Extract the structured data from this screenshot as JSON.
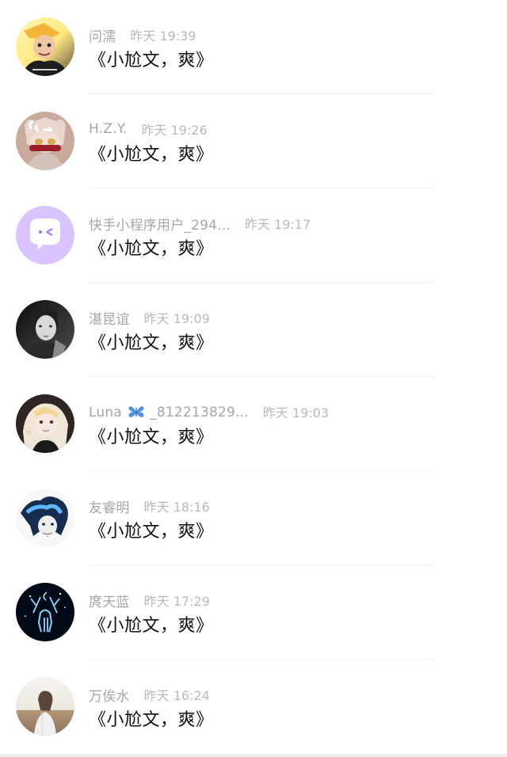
{
  "comments": [
    {
      "name": "问濡",
      "time": "昨天 19:39",
      "message": "《小尬文，爽》",
      "avatar": "cartoon-yellow-hat"
    },
    {
      "name": "H.Z.Y.",
      "time": "昨天 19:26",
      "message": "《小尬文，爽》",
      "avatar": "anime-cat-ears"
    },
    {
      "name": "快手小程序用户_294...",
      "time": "昨天 19:17",
      "message": "《小尬文，爽》",
      "avatar": "purple-chat-bubble"
    },
    {
      "name": "湛昆谊",
      "time": "昨天 19:09",
      "message": "《小尬文，爽》",
      "avatar": "mono-portrait"
    },
    {
      "name_prefix": "Luna",
      "name_suffix": "_812213829...",
      "time": "昨天 19:03",
      "message": "《小尬文，爽》",
      "avatar": "blonde-girl",
      "name_icon": "butterfly-icon"
    },
    {
      "name": "友睿明",
      "time": "昨天 18:16",
      "message": "《小尬文，爽》",
      "avatar": "anime-blue-hair"
    },
    {
      "name": "庹天蓝",
      "time": "昨天 17:29",
      "message": "《小尬文，爽》",
      "avatar": "night-deer"
    },
    {
      "name": "万俟水",
      "time": "昨天 16:24",
      "message": "《小尬文，爽》",
      "avatar": "sunset-girl"
    }
  ],
  "colors": {
    "name": "#a6a6a6",
    "time": "#b9b9b9",
    "message": "#111111",
    "background": "#ffffff",
    "accent_purple": "#d9c4ff",
    "butterfly": "#4d8fe8"
  }
}
